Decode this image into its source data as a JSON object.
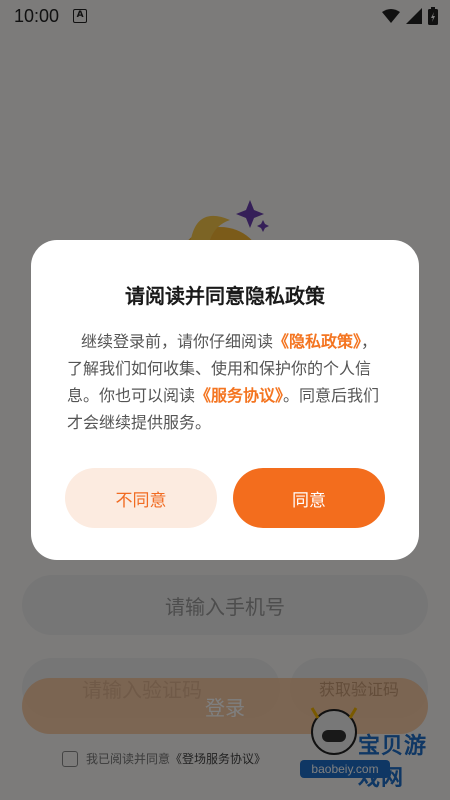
{
  "status_bar": {
    "time": "10:00",
    "notification_icon_letter": "A",
    "icons": [
      "wifi-icon",
      "signal-icon",
      "battery-charging-icon"
    ]
  },
  "login_form": {
    "phone_placeholder": "请输入手机号",
    "code_placeholder": "请输入验证码",
    "get_code_label": "获取验证码",
    "login_label": "登录",
    "agreement_text": "我已阅读并同意",
    "agreement_link": "《登场服务协议》"
  },
  "dialog": {
    "title": "请阅读并同意隐私政策",
    "body_part1": "继续登录前，请你仔细阅读",
    "privacy_link": "《隐私政策》",
    "body_part2": "，了解我们如何收集、使用和保护你的个人信息。你也可以阅读",
    "service_link": "《服务协议》",
    "body_part3": "。同意后我们才会继续提供服务。",
    "decline_label": "不同意",
    "agree_label": "同意"
  },
  "watermark": {
    "title": "宝贝游戏网",
    "url": "baobeiy.com"
  },
  "colors": {
    "accent": "#f36d1d",
    "link": "#f47521",
    "decline_bg": "#fcebe0"
  }
}
